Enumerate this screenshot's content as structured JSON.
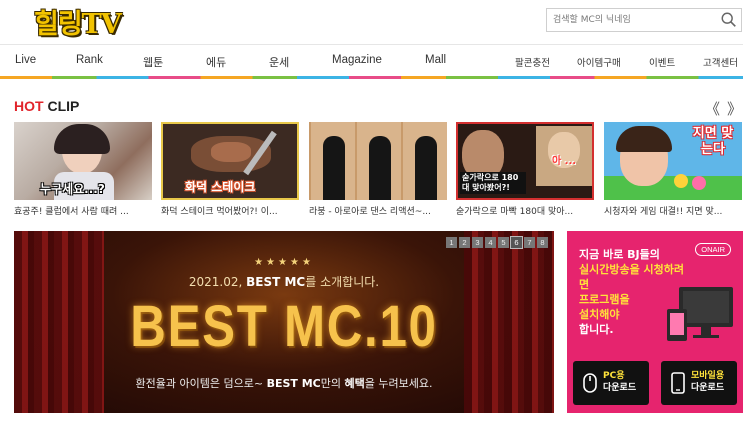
{
  "header": {
    "logo_text": "힐링TV",
    "search_placeholder": "검색할 MC의 닉네임"
  },
  "nav": {
    "items": [
      "Live",
      "Rank",
      "웹툰",
      "에듀",
      "운세",
      "Magazine",
      "Mall"
    ],
    "right_items": [
      "팔콘충전",
      "아이템구매",
      "이벤트",
      "고객센터"
    ]
  },
  "hot_clip": {
    "title_hot": "HOT",
    "title_clip": " CLIP",
    "prev_icon": "《",
    "next_icon": "》",
    "clips": [
      {
        "title": "효공주! 클럽에서 사람 때려 ...",
        "caption": "누구세요...?"
      },
      {
        "title": "화덕 스테이크 먹어봤어?! 이...",
        "caption": "화덕 스테이크"
      },
      {
        "title": "라붕 - 아로아로 댄스 리액션~...",
        "caption": ""
      },
      {
        "title": "숟가락으로 마빡 180대 맞아...",
        "caption": "숟가락으로 180대 맞아봤어?!",
        "caption2": "아 ..."
      },
      {
        "title": "시청자와 게임 대결!! 지면 맞...",
        "caption": "지면 맞는다"
      }
    ]
  },
  "banner": {
    "pages": [
      "1",
      "2",
      "3",
      "4",
      "5",
      "6",
      "7",
      "8"
    ],
    "active_page": "6",
    "stars": "★★★★★",
    "subtitle_pre": "2021.02, ",
    "subtitle_bold": "BEST MC",
    "subtitle_post": "를 소개합니다.",
    "headline": "BEST MC.10",
    "desc_pre": "환전율과 아이템은 덤으로~ ",
    "desc_bold1": "BEST MC",
    "desc_mid": "만의 ",
    "desc_bold2": "혜택",
    "desc_post": "을 누려보세요."
  },
  "side_ad": {
    "onair": "ONAIR",
    "line1": "지금 바로 BJ들의",
    "line2": "실시간방송을 시청하려면",
    "line3": "프로그램을",
    "line4": "설치해야",
    "line5": "합니다.",
    "pc_label_1": "PC용",
    "pc_label_2": "다운로드",
    "mobile_label_1": "모바일용",
    "mobile_label_2": "다운로드"
  }
}
